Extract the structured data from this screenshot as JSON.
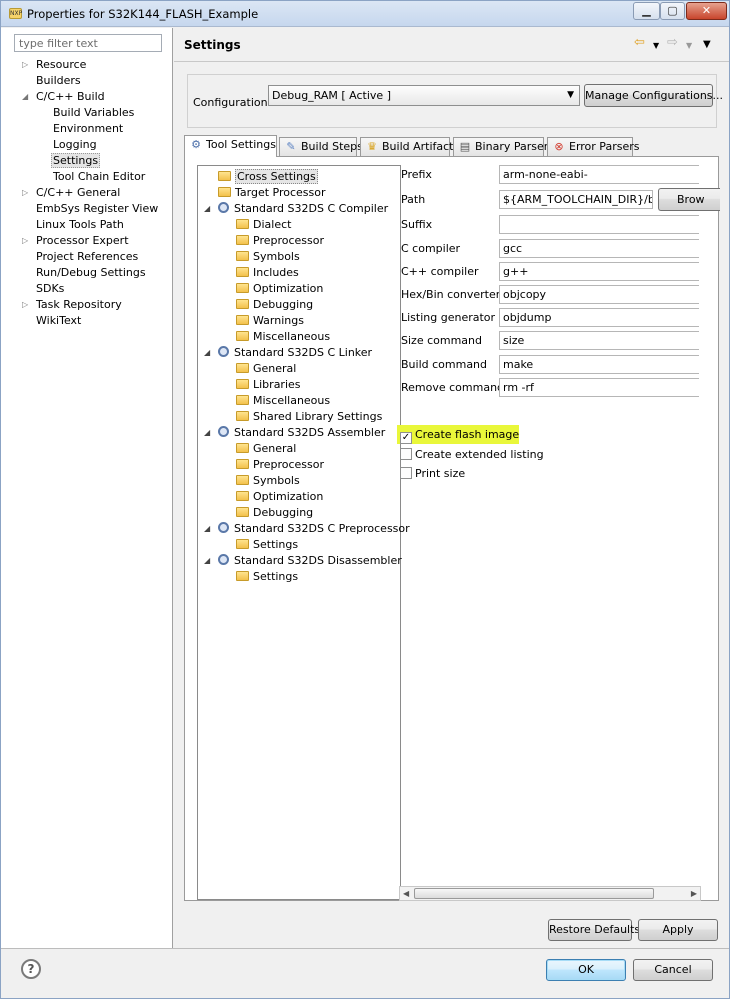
{
  "window": {
    "title": "Properties for S32K144_FLASH_Example",
    "app_icon": "eclipse-icon",
    "controls": [
      "minimize-icon",
      "maximize-icon",
      "close-icon"
    ]
  },
  "left_pane": {
    "filter_placeholder": "type filter text",
    "items": [
      {
        "label": "Resource",
        "expandable": true,
        "expanded": false,
        "level": 0
      },
      {
        "label": "Builders",
        "expandable": false,
        "level": 0
      },
      {
        "label": "C/C++ Build",
        "expandable": true,
        "expanded": true,
        "level": 0
      },
      {
        "label": "Build Variables",
        "level": 1
      },
      {
        "label": "Environment",
        "level": 1
      },
      {
        "label": "Logging",
        "level": 1
      },
      {
        "label": "Settings",
        "level": 1,
        "selected": true
      },
      {
        "label": "Tool Chain Editor",
        "level": 1
      },
      {
        "label": "C/C++ General",
        "expandable": true,
        "expanded": false,
        "level": 0
      },
      {
        "label": "EmbSys Register View",
        "level": 0
      },
      {
        "label": "Linux Tools Path",
        "level": 0
      },
      {
        "label": "Processor Expert",
        "expandable": true,
        "expanded": false,
        "level": 0
      },
      {
        "label": "Project References",
        "level": 0
      },
      {
        "label": "Run/Debug Settings",
        "level": 0
      },
      {
        "label": "SDKs",
        "level": 0
      },
      {
        "label": "Task Repository",
        "expandable": true,
        "expanded": false,
        "level": 0
      },
      {
        "label": "WikiText",
        "level": 0
      }
    ]
  },
  "header": {
    "title": "Settings",
    "nav_icons": [
      "back-arrow-icon",
      "dropdown-icon",
      "forward-arrow-icon",
      "dropdown-icon",
      "view-menu-icon"
    ]
  },
  "configuration": {
    "label": "Configuration:",
    "selected": "Debug_RAM  [ Active ]",
    "manage_button": "Manage Configurations..."
  },
  "tabs": [
    {
      "label": "Tool Settings",
      "icon": "tool-settings-icon",
      "active": true
    },
    {
      "label": "Build Steps",
      "icon": "build-steps-icon"
    },
    {
      "label": "Build Artifact",
      "icon": "build-artifact-icon"
    },
    {
      "label": "Binary Parsers",
      "icon": "binary-parsers-icon"
    },
    {
      "label": "Error Parsers",
      "icon": "error-parsers-icon"
    }
  ],
  "tool_tree": [
    {
      "label": "Cross Settings",
      "type": "folder",
      "level": 0,
      "selected": true
    },
    {
      "label": "Target Processor",
      "type": "folder",
      "level": 0
    },
    {
      "label": "Standard S32DS C Compiler",
      "type": "tool",
      "level": 0,
      "expanded": true
    },
    {
      "label": "Dialect",
      "type": "folder",
      "level": 1
    },
    {
      "label": "Preprocessor",
      "type": "folder",
      "level": 1
    },
    {
      "label": "Symbols",
      "type": "folder",
      "level": 1
    },
    {
      "label": "Includes",
      "type": "folder",
      "level": 1
    },
    {
      "label": "Optimization",
      "type": "folder",
      "level": 1
    },
    {
      "label": "Debugging",
      "type": "folder",
      "level": 1
    },
    {
      "label": "Warnings",
      "type": "folder",
      "level": 1
    },
    {
      "label": "Miscellaneous",
      "type": "folder",
      "level": 1
    },
    {
      "label": "Standard S32DS C Linker",
      "type": "tool",
      "level": 0,
      "expanded": true
    },
    {
      "label": "General",
      "type": "folder",
      "level": 1
    },
    {
      "label": "Libraries",
      "type": "folder",
      "level": 1
    },
    {
      "label": "Miscellaneous",
      "type": "folder",
      "level": 1
    },
    {
      "label": "Shared Library Settings",
      "type": "folder",
      "level": 1
    },
    {
      "label": "Standard S32DS Assembler",
      "type": "tool",
      "level": 0,
      "expanded": true
    },
    {
      "label": "General",
      "type": "folder",
      "level": 1
    },
    {
      "label": "Preprocessor",
      "type": "folder",
      "level": 1
    },
    {
      "label": "Symbols",
      "type": "folder",
      "level": 1
    },
    {
      "label": "Optimization",
      "type": "folder",
      "level": 1
    },
    {
      "label": "Debugging",
      "type": "folder",
      "level": 1
    },
    {
      "label": "Standard S32DS C Preprocessor",
      "type": "tool",
      "level": 0,
      "expanded": true
    },
    {
      "label": "Settings",
      "type": "folder",
      "level": 1
    },
    {
      "label": "Standard S32DS Disassembler",
      "type": "tool",
      "level": 0,
      "expanded": true
    },
    {
      "label": "Settings",
      "type": "folder",
      "level": 1
    }
  ],
  "form": {
    "fields": [
      {
        "label": "Prefix",
        "value": "arm-none-eabi-"
      },
      {
        "label": "Path",
        "value": "${ARM_TOOLCHAIN_DIR}/bin"
      },
      {
        "label": "Suffix",
        "value": ""
      },
      {
        "label": "C compiler",
        "value": "gcc"
      },
      {
        "label": "C++ compiler",
        "value": "g++"
      },
      {
        "label": "Hex/Bin converter",
        "value": "objcopy"
      },
      {
        "label": "Listing generator",
        "value": "objdump"
      },
      {
        "label": "Size command",
        "value": "size"
      },
      {
        "label": "Build command",
        "value": "make"
      },
      {
        "label": "Remove command",
        "value": "rm -rf"
      }
    ],
    "browse_button": "Brow",
    "checkboxes": [
      {
        "label": "Create flash image",
        "checked": true,
        "highlighted": true
      },
      {
        "label": "Create extended listing",
        "checked": false
      },
      {
        "label": "Print size",
        "checked": false
      }
    ]
  },
  "buttons": {
    "restore_defaults": "Restore Defaults",
    "apply": "Apply",
    "ok": "OK",
    "cancel": "Cancel"
  },
  "help_icon": "help-icon",
  "colors": {
    "highlight": "#e9f73a",
    "selection": "#e5e5e5"
  }
}
